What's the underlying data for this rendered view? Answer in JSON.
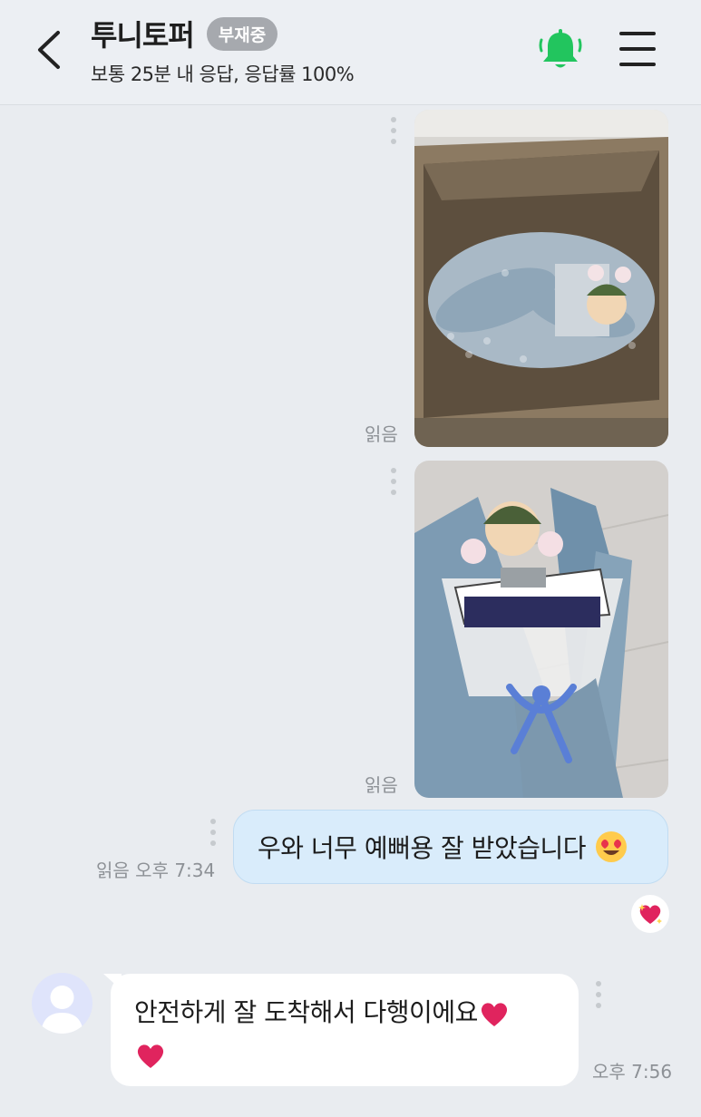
{
  "header": {
    "title": "투니토퍼",
    "status_badge": "부재중",
    "subtitle": "보통 25분 내 응답, 응답률 100%",
    "back_icon": "chevron-left-icon",
    "bell_icon": "bell-icon",
    "menu_icon": "hamburger-menu-icon",
    "accent_color": "#22c55e"
  },
  "messages": [
    {
      "type": "image",
      "direction": "outgoing",
      "description_icon": "photo-box-icon",
      "read": "읽음"
    },
    {
      "type": "image",
      "direction": "outgoing",
      "description_icon": "photo-bouquet-icon",
      "read": "읽음"
    },
    {
      "type": "text",
      "direction": "outgoing",
      "text": "우와 너무 예뻐용 잘 받았습니다",
      "emoji": "heart-eyes-emoji-icon",
      "read": "읽음",
      "time": "오후 7:34",
      "reaction_icon": "heart-sparkle-icon"
    },
    {
      "type": "text",
      "direction": "incoming",
      "text": "안전하게 잘 도착해서 다행이에요",
      "emoji": "red-heart-icon",
      "time": "오후 7:56"
    }
  ]
}
